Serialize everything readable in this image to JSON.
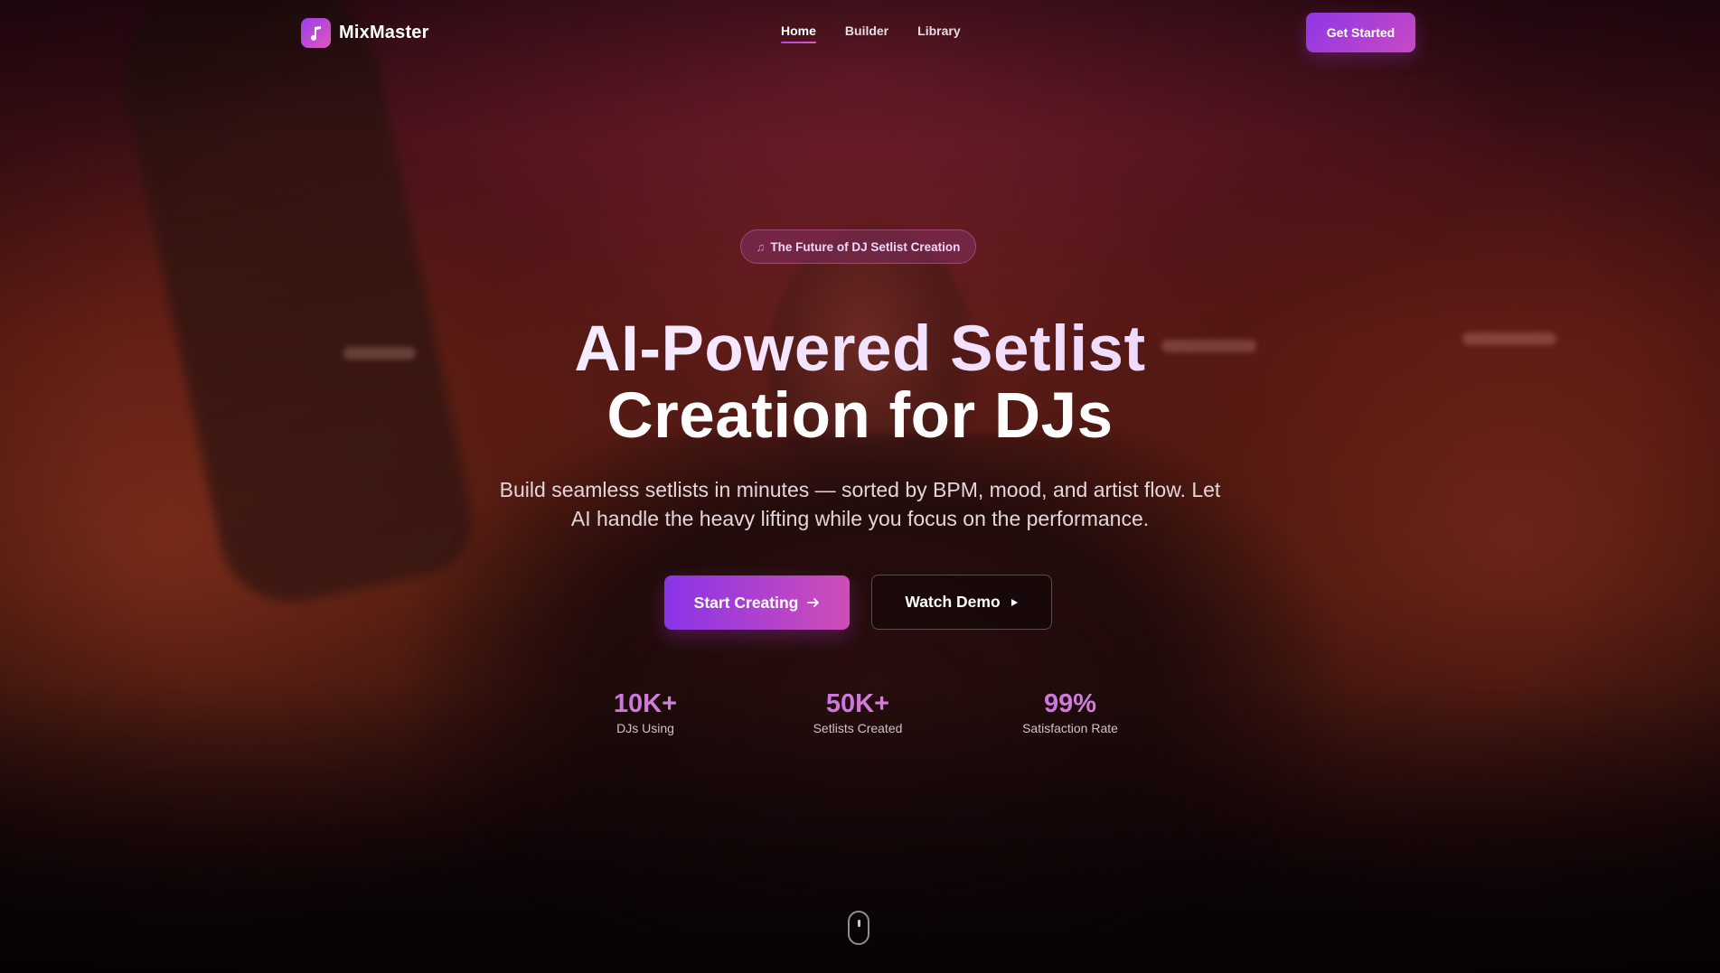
{
  "nav": {
    "brand": "MixMaster",
    "links": [
      {
        "label": "Home",
        "active": true
      },
      {
        "label": "Builder",
        "active": false
      },
      {
        "label": "Library",
        "active": false
      }
    ],
    "cta_label": "Get Started"
  },
  "hero": {
    "badge": "The Future of DJ Setlist Creation",
    "title_line1": "AI-Powered Setlist",
    "title_line2": "Creation for DJs",
    "subtitle": "Build seamless setlists in minutes — sorted by BPM, mood, and artist flow. Let AI handle the heavy lifting while you focus on the performance.",
    "primary_button": "Start Creating",
    "secondary_button": "Watch Demo"
  },
  "stats": [
    {
      "value": "10K+",
      "label": "DJs Using"
    },
    {
      "value": "50K+",
      "label": "Setlists Created"
    },
    {
      "value": "99%",
      "label": "Satisfaction Rate"
    }
  ],
  "icons": {
    "logo": "music-note-icon",
    "badge": "music-note-icon",
    "primary_button": "arrow-right-icon",
    "secondary_button": "play-icon",
    "scroll": "mouse-scroll-icon"
  },
  "colors": {
    "accent_start": "#8a34e8",
    "accent_end": "#d04db6",
    "stat_value": "#d07ade"
  }
}
